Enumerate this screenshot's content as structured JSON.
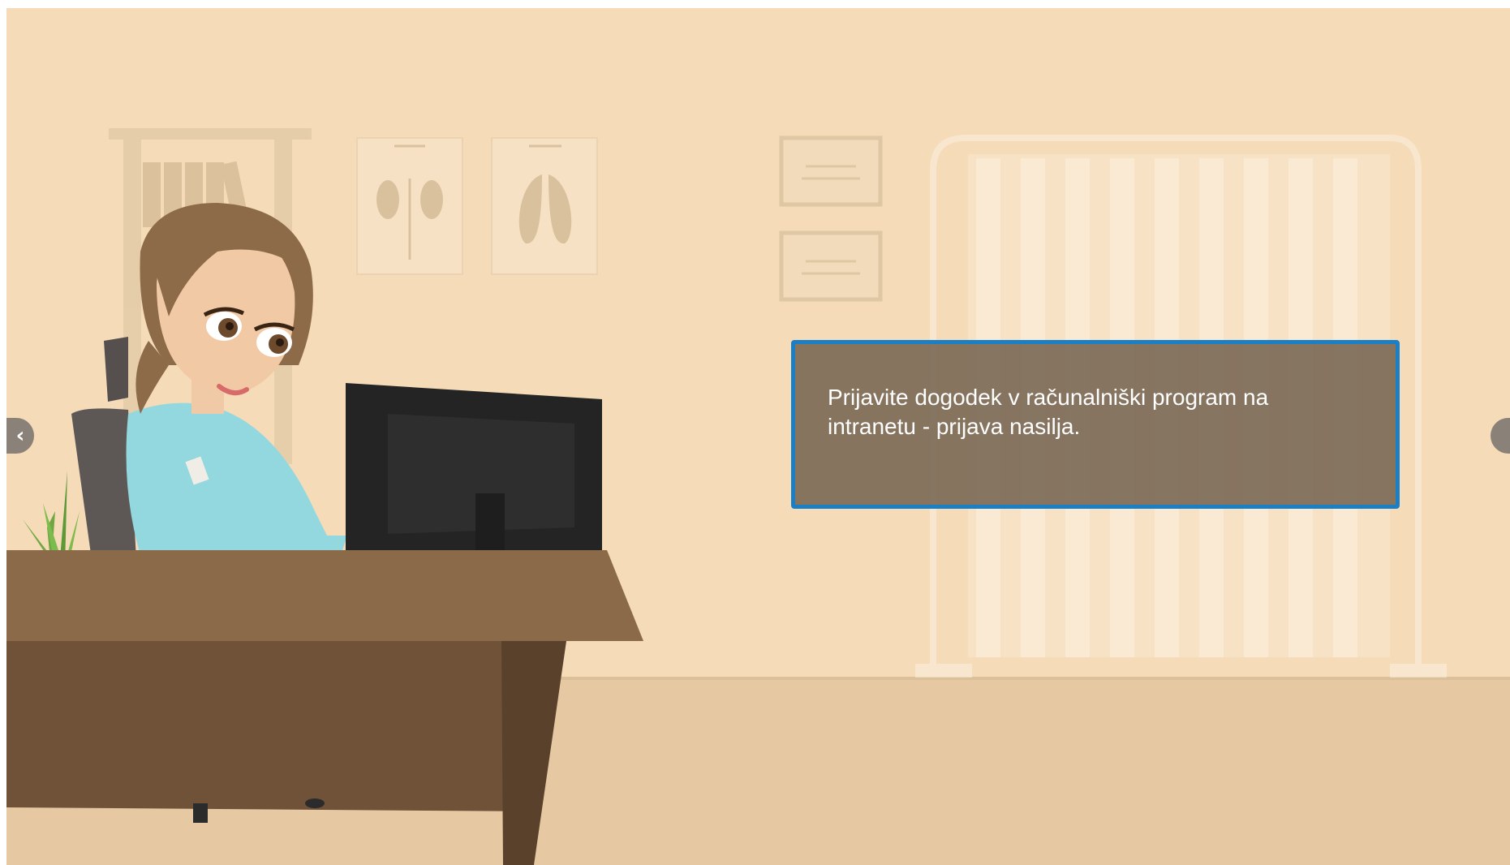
{
  "slide": {
    "message": "Prijavite dogodek v računalniški program na intranetu - prijava nasilja."
  },
  "navigation": {
    "prev_icon": "chevron-left-icon",
    "next_icon": "chevron-right-icon",
    "prev_glyph": "‹",
    "next_glyph": ""
  },
  "colors": {
    "wall": "#f5dbb8",
    "floor": "#e6c9a3",
    "desk": "#7a5a3e",
    "textbox_bg": "#7d6c58",
    "textbox_border": "#1b7fc5"
  }
}
